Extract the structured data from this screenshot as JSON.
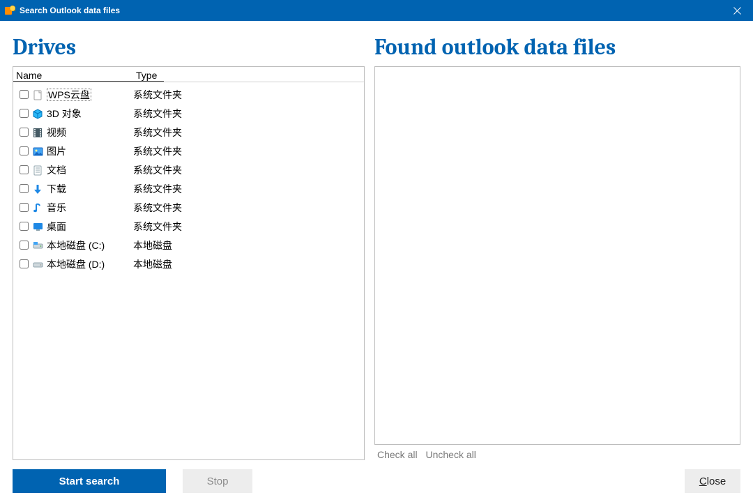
{
  "window": {
    "title": "Search Outlook data files"
  },
  "headings": {
    "drives": "Drives",
    "found": "Found outlook data files"
  },
  "columns": {
    "name": "Name",
    "type": "Type"
  },
  "rows": [
    {
      "icon": "page",
      "name": "WPS云盘",
      "type": "系统文件夹",
      "selected": true
    },
    {
      "icon": "cube",
      "name": "3D 对象",
      "type": "系统文件夹"
    },
    {
      "icon": "film",
      "name": "视频",
      "type": "系统文件夹"
    },
    {
      "icon": "picture",
      "name": "图片",
      "type": "系统文件夹"
    },
    {
      "icon": "doc",
      "name": "文档",
      "type": "系统文件夹"
    },
    {
      "icon": "download",
      "name": "下载",
      "type": "系统文件夹"
    },
    {
      "icon": "music",
      "name": "音乐",
      "type": "系统文件夹"
    },
    {
      "icon": "desktop",
      "name": "桌面",
      "type": "系统文件夹"
    },
    {
      "icon": "drive1",
      "name": "本地磁盘 (C:)",
      "type": "本地磁盘"
    },
    {
      "icon": "drive2",
      "name": "本地磁盘 (D:)",
      "type": "本地磁盘"
    }
  ],
  "links": {
    "check_all": "Check all",
    "uncheck_all": "Uncheck all"
  },
  "buttons": {
    "start": "Start search",
    "stop": "Stop",
    "close_prefix": "C",
    "close_rest": "lose"
  }
}
